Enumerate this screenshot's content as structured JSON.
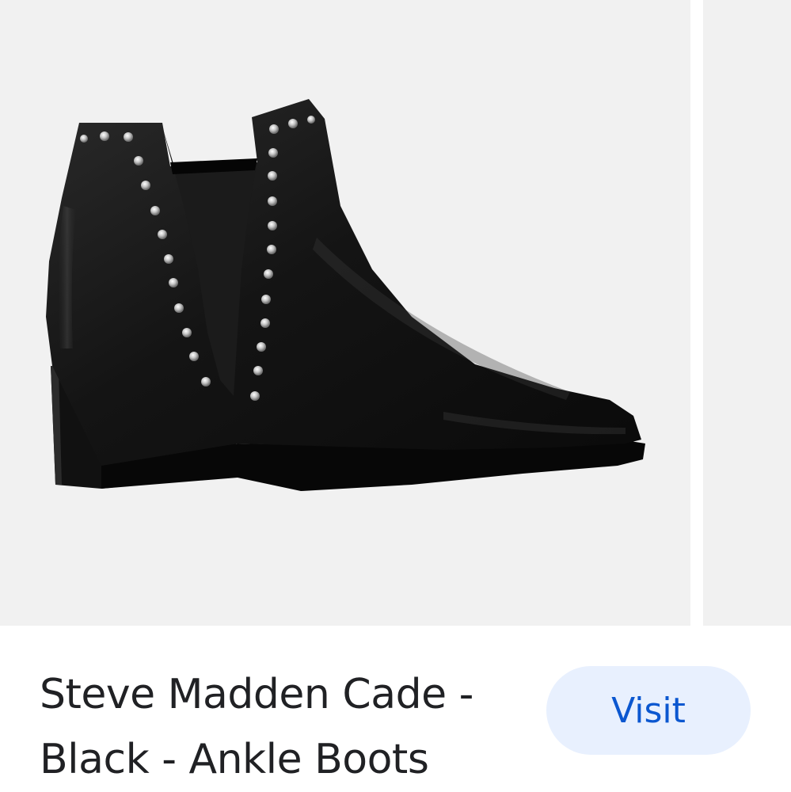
{
  "product": {
    "title": "Steve Madden Cade - Black - Ankle Boots",
    "image_subject": "black leather studded ankle boot"
  },
  "actions": {
    "visit_label": "Visit"
  },
  "colors": {
    "image_background": "#f1f1f1",
    "button_background": "#e8f0fe",
    "button_text": "#0b57d0",
    "title_text": "#202124"
  }
}
